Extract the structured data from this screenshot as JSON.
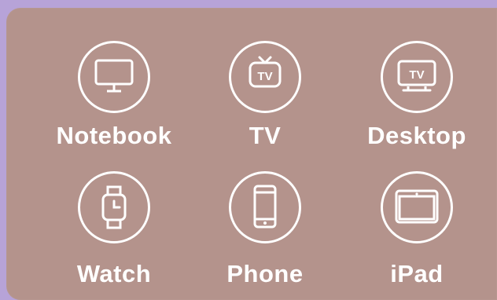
{
  "devices": [
    {
      "label": "Notebook",
      "icon": "monitor-icon"
    },
    {
      "label": "TV",
      "icon": "tv-icon"
    },
    {
      "label": "Desktop",
      "icon": "desktop-tv-icon"
    },
    {
      "label": "Watch",
      "icon": "watch-icon"
    },
    {
      "label": "Phone",
      "icon": "phone-icon"
    },
    {
      "label": "iPad",
      "icon": "tablet-icon"
    }
  ],
  "icon_text": {
    "tv": "TV",
    "desktop": "TV"
  },
  "colors": {
    "background": "#b7a3d8",
    "panel": "#b4938c",
    "foreground": "#ffffff"
  }
}
